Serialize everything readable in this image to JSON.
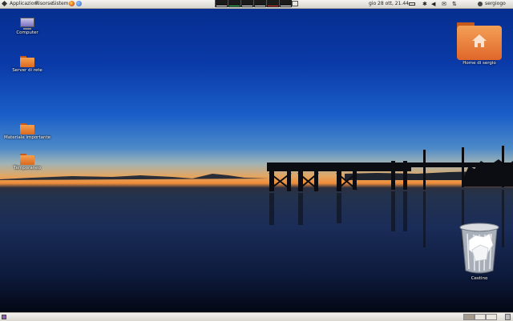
{
  "top_panel": {
    "menus": [
      "Applicazioni",
      "Risorse",
      "Sistema"
    ],
    "clock": "gio 28 ott, 21.44",
    "user": "sergiogo",
    "workspace_indicator_colors": [
      "#ffffff",
      "#3fd06a",
      "#ffffff",
      "#ffffff",
      "#e23b3b",
      "#ffffff"
    ]
  },
  "desktop_icons": {
    "computer": "Computer",
    "server": "Server di rete",
    "materiale": "Materiale importante",
    "temporaneo": "Temporaneo",
    "home": "Home di sergio",
    "trash": "Cestino"
  },
  "colors": {
    "folder_orange": "#e0662a",
    "panel_bg": "#d9d6cf"
  }
}
